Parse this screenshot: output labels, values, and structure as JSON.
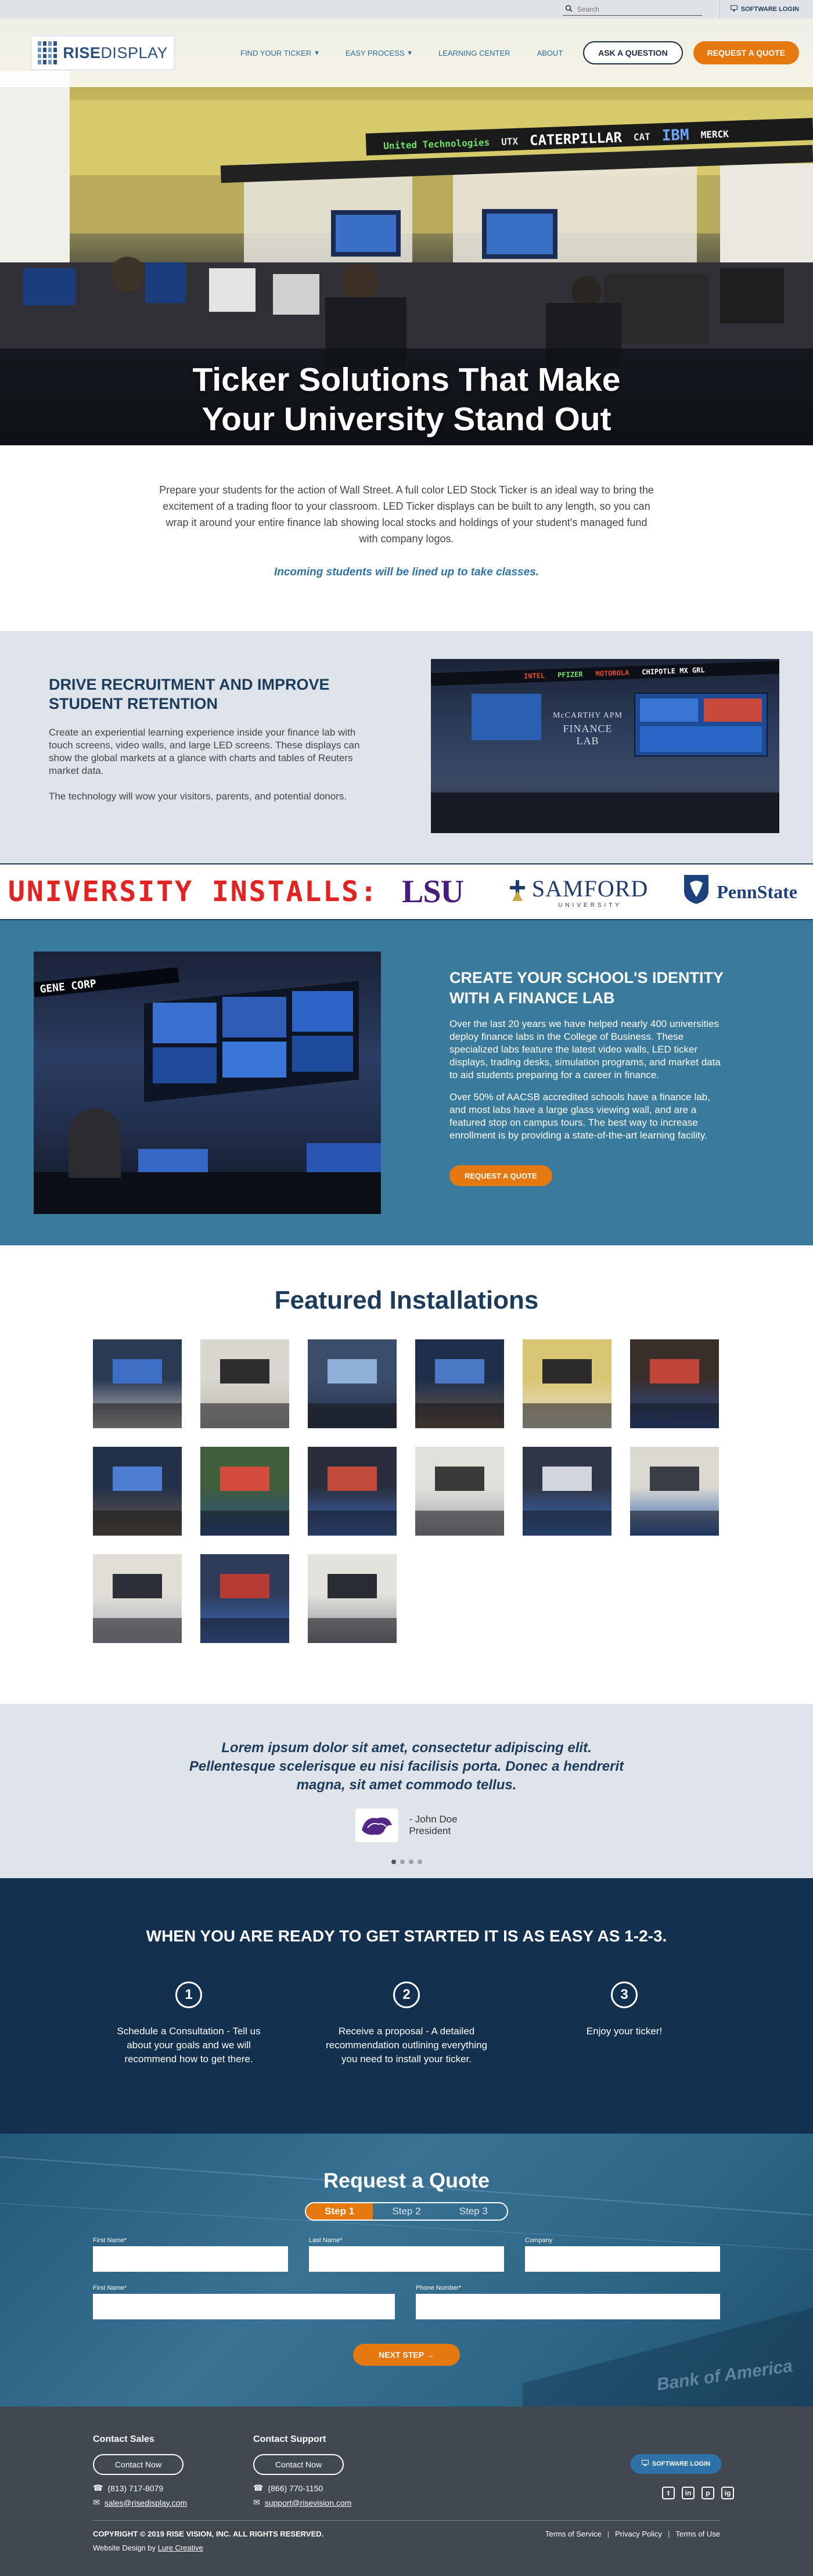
{
  "util": {
    "search_placeholder": "Search",
    "software_login": "SOFTWARE LOGIN"
  },
  "header": {
    "logo_bold": "RISE",
    "logo_light": "DISPLAY",
    "nav": [
      "FIND YOUR TICKER",
      "EASY PROCESS",
      "LEARNING CENTER",
      "ABOUT"
    ],
    "ask": "ASK A QUESTION",
    "request": "REQUEST A QUOTE"
  },
  "hero": {
    "ticker_items": [
      "United Technologies",
      "UTX",
      "CATERPILLAR",
      "CAT",
      "IBM",
      "MERCK"
    ],
    "title_line1": "Ticker Solutions That Make",
    "title_line2": "Your University Stand Out"
  },
  "intro": {
    "body": "Prepare your students for the action of Wall Street. A full color LED Stock Ticker is an ideal way to bring the excitement of a trading floor to your classroom. LED Ticker displays can be built to any length, so you can wrap it around your entire finance lab showing local stocks and holdings of your student's managed fund with company logos.",
    "tagline": "Incoming students will be lined up to take classes."
  },
  "drive": {
    "title": "DRIVE RECRUITMENT AND IMPROVE STUDENT RETENTION",
    "p1": "Create an experiential learning experience inside your finance lab with touch screens, video walls, and large LED screens. These displays can show the global markets at a glance with charts and tables of Reuters market data.",
    "p2": "The technology will wow your visitors, parents, and potential donors.",
    "img_ticker": [
      "INTEL",
      "PFIZER",
      "MOTOROLA",
      "CHIPOTLE MX GRL"
    ],
    "img_caption_1": "McCARTHY APM",
    "img_caption_2": "FINANCE LAB"
  },
  "installs": {
    "label": "UNIVERSITY INSTALLS:",
    "lsu": "LSU",
    "samford": "SAMFORD",
    "samford_sub": "UNIVERSITY",
    "penn": "PennState"
  },
  "identity": {
    "title": "CREATE YOUR SCHOOL'S IDENTITY WITH A FINANCE LAB",
    "p1": "Over the last 20 years we have helped nearly 400 universities deploy finance labs in the College of Business. These specialized labs feature the latest video walls, LED ticker displays, trading desks, simulation programs, and market data to aid students preparing for a career in finance.",
    "p2": "Over 50% of AACSB accredited schools have a finance lab, and most labs have a large glass viewing wall, and are a featured stop on campus tours. The best way to increase enrollment is by providing a state-of-the-art learning facility.",
    "button": "REQUEST A QUOTE",
    "img_ticker": "GENE CORP"
  },
  "featured": {
    "title": "Featured Installations",
    "count": 15
  },
  "testimonial": {
    "quote": "Lorem ipsum dolor sit amet, consectetur adipiscing elit. Pellentesque scelerisque eu nisi facilisis porta. Donec a hendrerit magna, sit amet commodo tellus.",
    "name": "- John Doe",
    "role": "President",
    "slides": 4,
    "active": 0
  },
  "steps": {
    "title": "WHEN YOU ARE READY TO GET STARTED IT IS AS EASY AS 1-2-3.",
    "items": [
      {
        "num": "1",
        "text": "Schedule a Consultation - Tell us about your goals and we will recommend how to get there."
      },
      {
        "num": "2",
        "text": "Receive a proposal - A detailed recommendation outlining everything you need to install your ticker."
      },
      {
        "num": "3",
        "text": "Enjoy your ticker!"
      }
    ]
  },
  "quote": {
    "title": "Request a Quote",
    "steps": [
      "Step 1",
      "Step 2",
      "Step 3"
    ],
    "active_step": 0,
    "fields": [
      "First Name*",
      "Last Name*",
      "Company",
      "First Name*",
      "Phone Number*"
    ],
    "next": "NEXT STEP",
    "bg_sign": "Bank of America"
  },
  "footer": {
    "sales_title": "Contact Sales",
    "support_title": "Contact Support",
    "contact_btn": "Contact Now",
    "sales_phone": "(813) 717-8079",
    "sales_email": "sales@risedisplay.com",
    "support_phone": "(866) 770-1150",
    "support_email": "support@risevision.com",
    "software_login": "SOFTWARE LOGIN",
    "social": [
      "t",
      "in",
      "p",
      "ig"
    ],
    "copyright": "COPYRIGHT © 2019 RISE VISION, INC. ALL RIGHTS RESERVED.",
    "design_prefix": "Website Design by",
    "design_link": "Lure Creative",
    "legal": [
      "Terms of Service",
      "Privacy Policy",
      "Terms of Use"
    ],
    "legal_sep": "|"
  },
  "colors": {
    "navy": "#1d3b5a",
    "orange": "#e5780f",
    "teal": "#3a7a9c",
    "light_bg": "#dfe3ea"
  }
}
